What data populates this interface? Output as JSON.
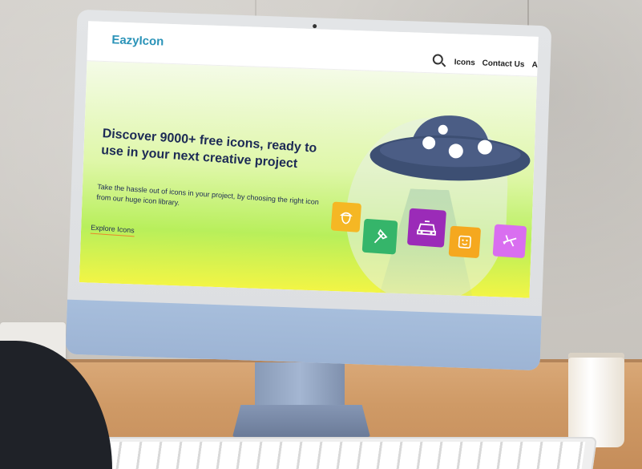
{
  "site": {
    "logo": "EazyIcon",
    "nav": {
      "icons": "Icons",
      "contact": "Contact Us",
      "about": "Ab"
    }
  },
  "hero": {
    "title": "Discover 9000+ free icons, ready to use in your next creative project",
    "subtitle": "Take the hassle out of icons in your project, by choosing the right icon from our huge icon library.",
    "cta": "Explore Icons"
  },
  "icons": {
    "search": "search-icon",
    "tiles": [
      {
        "name": "acorn-icon",
        "color": "#f5b724"
      },
      {
        "name": "axe-icon",
        "color": "#35b56a"
      },
      {
        "name": "car-icon",
        "color": "#9b2bb8"
      },
      {
        "name": "face-icon",
        "color": "#f5a81f"
      },
      {
        "name": "airplane-icon",
        "color": "#d96ef0"
      }
    ]
  },
  "colors": {
    "brand": "#2a93b8",
    "heading": "#1c2a55",
    "cta_underline": "#e9872b",
    "ufo": "#3d4f73"
  }
}
